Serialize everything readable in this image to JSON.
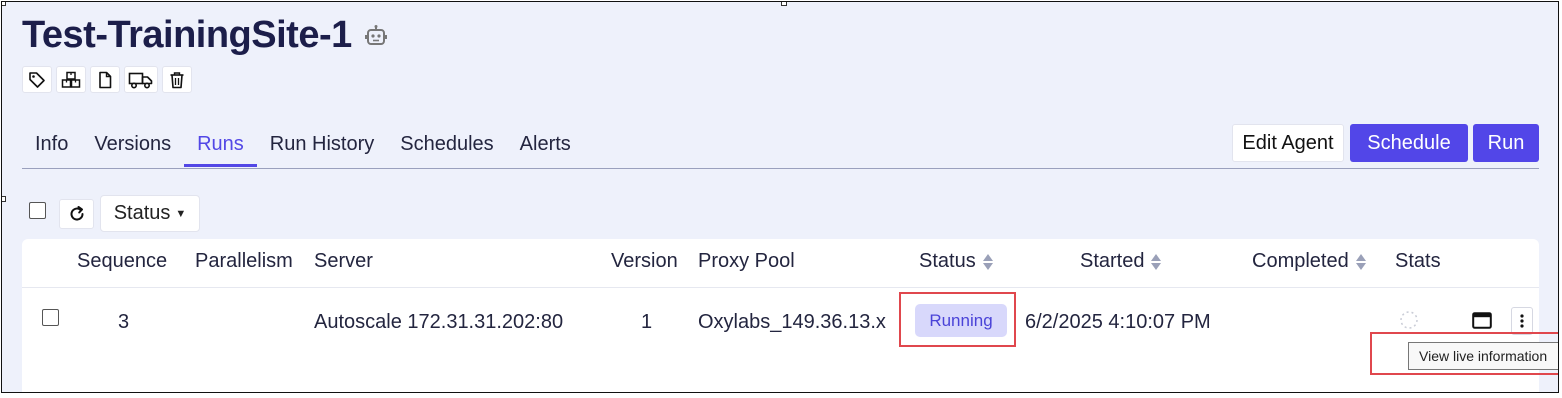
{
  "page": {
    "title": "Test-TrainingSite-1",
    "icons": [
      "robot-icon",
      "tag-icon",
      "boxes-icon",
      "file-icon",
      "truck-icon",
      "trash-icon"
    ]
  },
  "tabs": [
    {
      "label": "Info",
      "active": false
    },
    {
      "label": "Versions",
      "active": false
    },
    {
      "label": "Runs",
      "active": true
    },
    {
      "label": "Run History",
      "active": false
    },
    {
      "label": "Schedules",
      "active": false
    },
    {
      "label": "Alerts",
      "active": false
    }
  ],
  "actions": {
    "edit_agent": "Edit Agent",
    "schedule": "Schedule",
    "run": "Run"
  },
  "toolbar": {
    "status_filter": "Status"
  },
  "table": {
    "columns": [
      "Sequence",
      "Parallelism",
      "Server",
      "Version",
      "Proxy Pool",
      "Status",
      "Started",
      "Completed",
      "Stats"
    ],
    "rows": [
      {
        "sequence": "3",
        "parallelism": "",
        "server": "Autoscale 172.31.31.202:80",
        "version": "1",
        "proxy_pool": "Oxylabs_149.36.13.x",
        "status": "Running",
        "started": "6/2/2025 4:10:07 PM",
        "completed": ""
      }
    ]
  },
  "tooltip": "View live information",
  "colors": {
    "accent": "#5246e8",
    "title": "#1c1e4a",
    "highlight": "#e0474d",
    "badge_bg": "#d8d8fb",
    "background": "#eef1fb"
  }
}
